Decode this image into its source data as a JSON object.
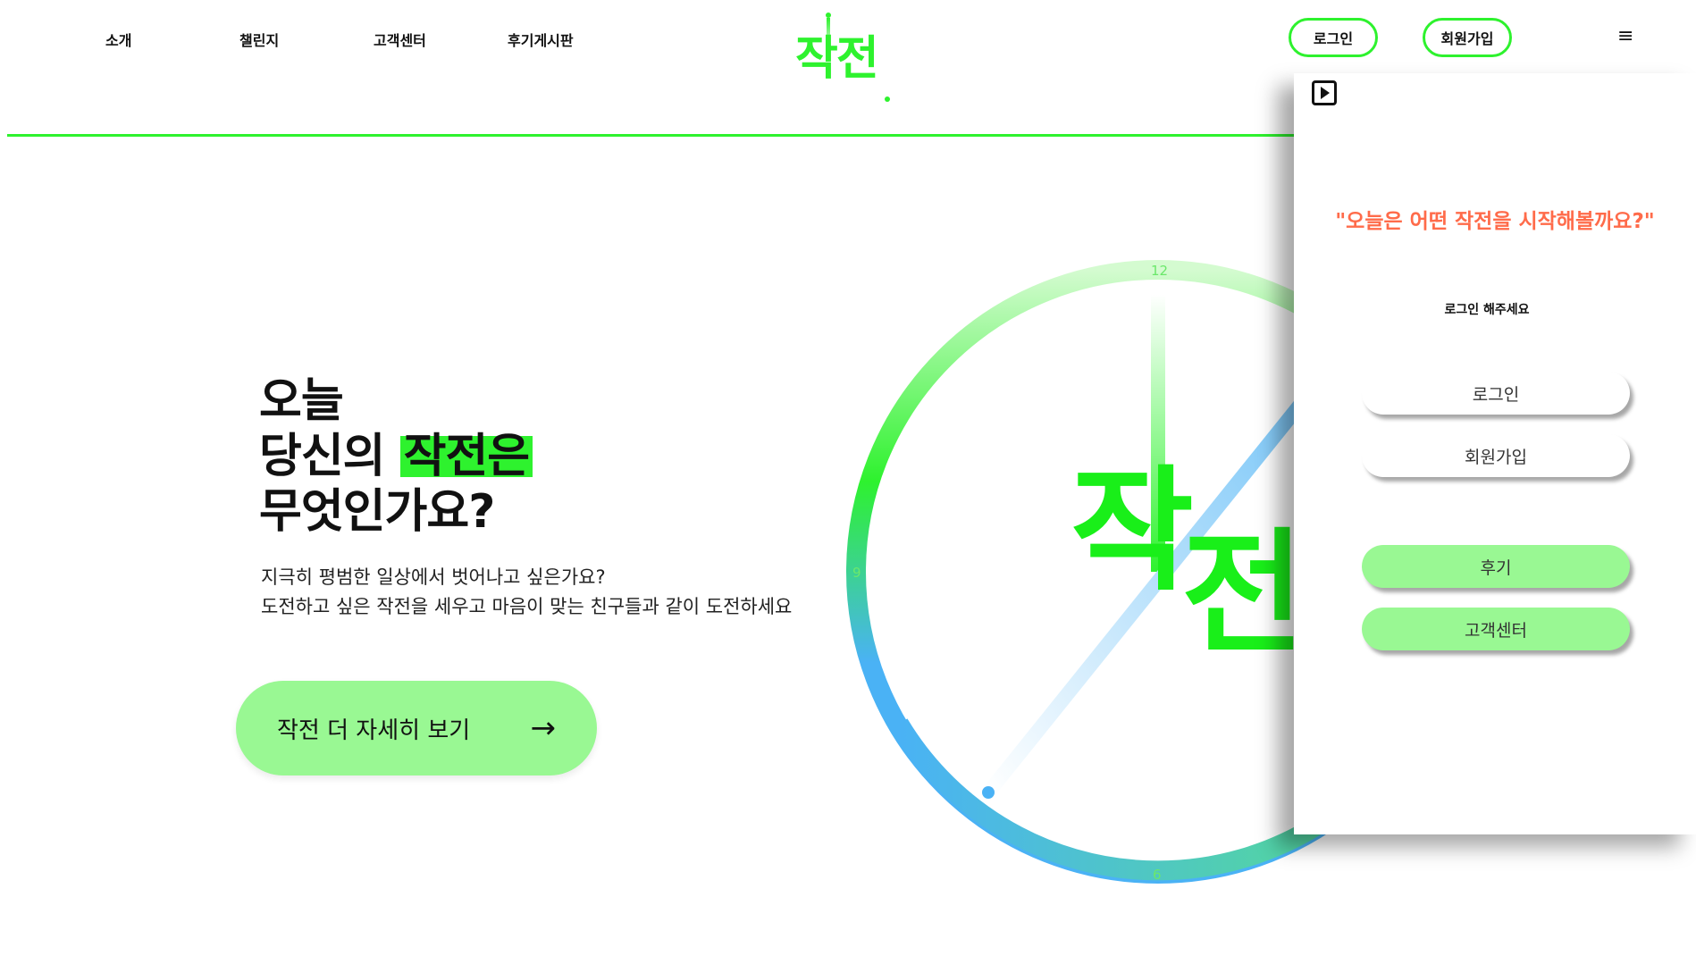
{
  "nav": {
    "links": [
      "소개",
      "챌린지",
      "고객센터",
      "후기게시판"
    ],
    "logo_text": "작전",
    "login_label": "로그인",
    "signup_label": "회원가입",
    "menu_icon": "≡"
  },
  "hero": {
    "title_line1": "오늘",
    "title_line2a": "당신의 ",
    "title_highlight": "작전은",
    "title_line3": "무엇인가요?",
    "sub_line1": "지극히 평범한 일상에서 벗어나고 싶은가요?",
    "sub_line2": "도전하고 싶은 작전을 세우고 마음이 맞는 친구들과 같이 도전하세요",
    "cta_label": "작전 더 자세히 보기",
    "cta_arrow": "→"
  },
  "clock": {
    "label_12": "12",
    "label_6": "6",
    "label_9": "9",
    "word_1": "작",
    "word_2": "전"
  },
  "panel": {
    "quote": "\"오늘은 어떤 작전을 시작해볼까요?\"",
    "note": "로그인 해주세요",
    "login_label": "로그인",
    "signup_label": "회원가입",
    "review_label": "후기",
    "support_label": "고객센터"
  },
  "colors": {
    "brand_green": "#2ef22e",
    "button_green": "#99f893",
    "quote_orange": "#ff6b4a",
    "hand_blue": "#4ab2f5"
  }
}
